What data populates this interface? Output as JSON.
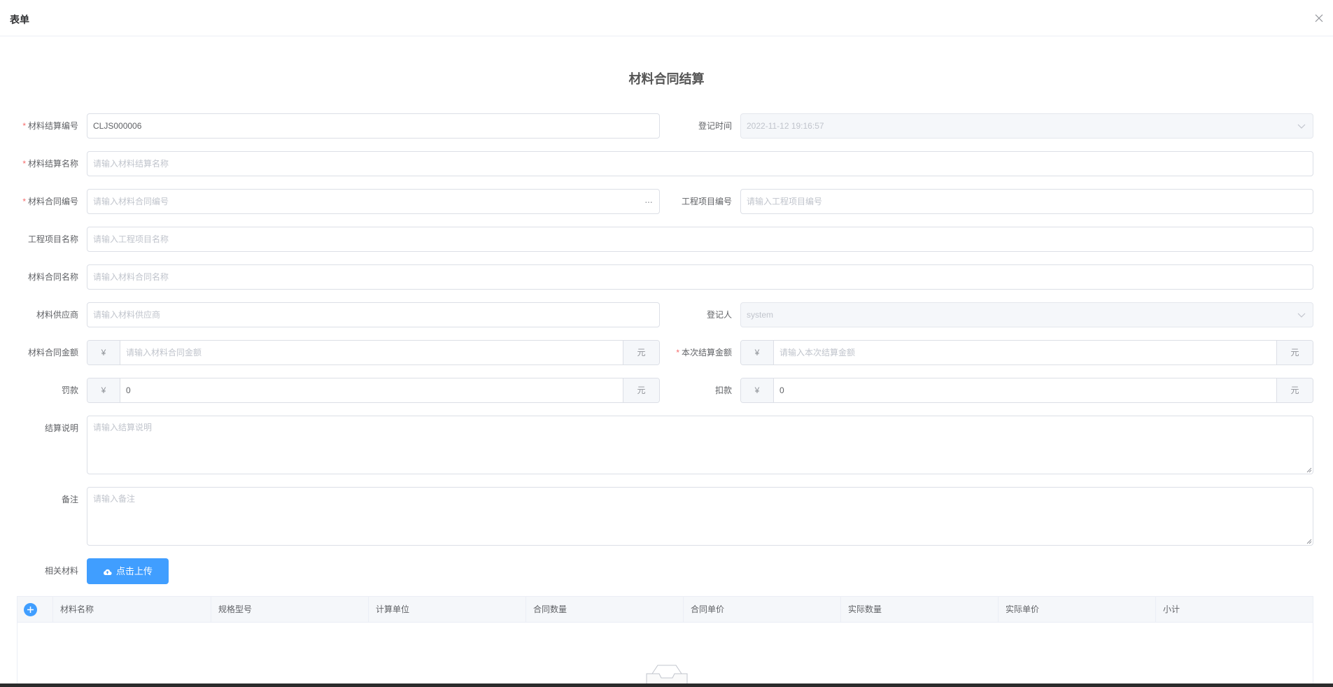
{
  "dialog": {
    "title": "表单"
  },
  "form": {
    "title": "材料合同结算",
    "settlement_no": {
      "label": "材料结算编号",
      "value": "CLJS000006"
    },
    "register_time": {
      "label": "登记时间",
      "value": "2022-11-12 19:16:57"
    },
    "settlement_name": {
      "label": "材料结算名称",
      "placeholder": "请输入材料结算名称"
    },
    "contract_no": {
      "label": "材料合同编号",
      "placeholder": "请输入材料合同编号",
      "suffix": "···"
    },
    "project_no": {
      "label": "工程项目编号",
      "placeholder": "请输入工程项目编号"
    },
    "project_name": {
      "label": "工程项目名称",
      "placeholder": "请输入工程项目名称"
    },
    "contract_name": {
      "label": "材料合同名称",
      "placeholder": "请输入材料合同名称"
    },
    "supplier": {
      "label": "材料供应商",
      "placeholder": "请输入材料供应商"
    },
    "registrar": {
      "label": "登记人",
      "value": "system"
    },
    "contract_amount": {
      "label": "材料合同金额",
      "prefix": "¥",
      "placeholder": "请输入材料合同金额",
      "suffix": "元"
    },
    "current_amount": {
      "label": "本次结算金额",
      "prefix": "¥",
      "placeholder": "请输入本次结算金额",
      "suffix": "元"
    },
    "penalty": {
      "label": "罚款",
      "prefix": "¥",
      "value": "0",
      "suffix": "元"
    },
    "deduction": {
      "label": "扣款",
      "prefix": "¥",
      "value": "0",
      "suffix": "元"
    },
    "description": {
      "label": "结算说明",
      "placeholder": "请输入结算说明"
    },
    "remark": {
      "label": "备注",
      "placeholder": "请输入备注"
    },
    "materials": {
      "label": "相关材料",
      "upload_label": "点击上传"
    }
  },
  "table": {
    "columns": [
      "材料名称",
      "规格型号",
      "计算单位",
      "合同数量",
      "合同单价",
      "实际数量",
      "实际单价",
      "小计"
    ]
  },
  "colors": {
    "primary": "#409eff",
    "required": "#f56c6c"
  }
}
